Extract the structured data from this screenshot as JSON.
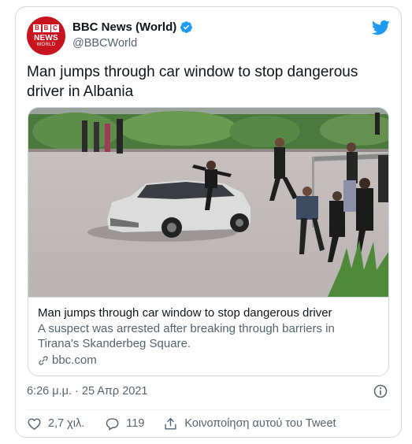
{
  "account": {
    "display_name": "BBC News (World)",
    "handle": "@BBCWorld",
    "avatar": {
      "blocks": [
        "B",
        "B",
        "C"
      ],
      "line1": "NEWS",
      "line2": "WORLD"
    }
  },
  "tweet": {
    "text": "Man jumps through car window to stop dangerous driver in Albania"
  },
  "card": {
    "title": "Man jumps through car window to stop dangerous driver",
    "description": "A suspect was arrested after breaking through barriers in Tirana's Skanderbeg Square.",
    "domain": "bbc.com"
  },
  "meta": {
    "timestamp": "6:26 μ.μ. · 25 Απρ 2021"
  },
  "actions": {
    "likes": "2,7 χιλ.",
    "replies": "119",
    "share_label": "Κοινοποίηση αυτού του Tweet"
  },
  "colors": {
    "brand_red": "#c8141e",
    "twitter_blue": "#1d9bf0",
    "secondary_text": "#536471",
    "border": "#cfd9de"
  },
  "icons": {
    "verified": "verified-badge-icon",
    "logo": "twitter-bird-icon",
    "link": "link-icon",
    "info": "info-icon",
    "like": "heart-icon",
    "reply": "reply-icon",
    "share": "share-icon"
  }
}
